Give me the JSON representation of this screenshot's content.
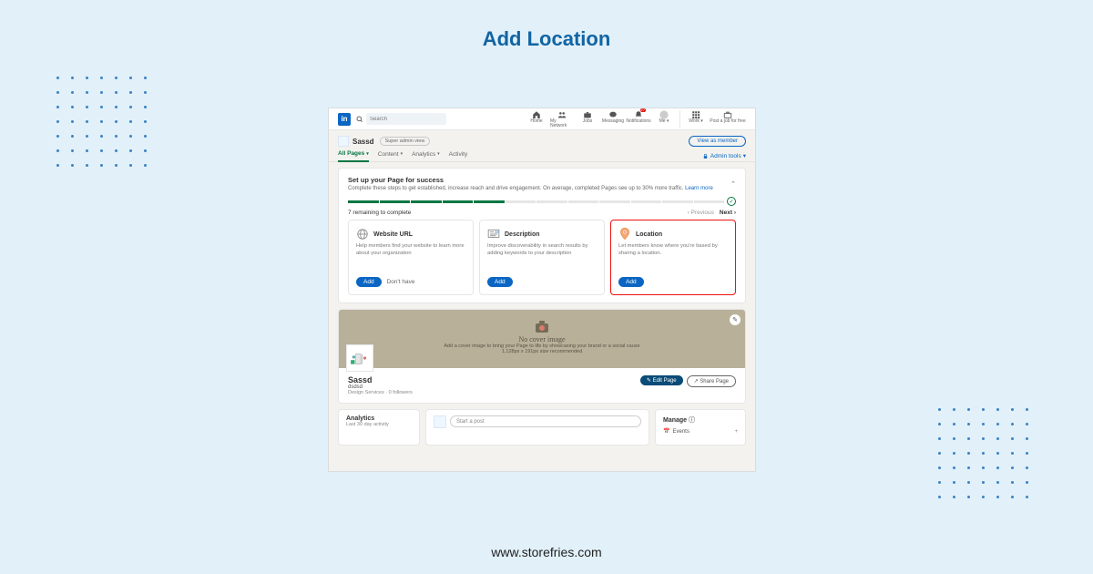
{
  "page_title": "Add Location",
  "footer_url": "www.storefries.com",
  "topbar": {
    "logo": "in",
    "search_placeholder": "Search",
    "nav": [
      {
        "label": "Home",
        "icon": "home"
      },
      {
        "label": "My Network",
        "icon": "people"
      },
      {
        "label": "Jobs",
        "icon": "briefcase"
      },
      {
        "label": "Messaging",
        "icon": "chat"
      },
      {
        "label": "Notifications",
        "icon": "bell",
        "badge": "27"
      },
      {
        "label": "Me",
        "icon": "avatar"
      },
      {
        "label": "Work",
        "icon": "grid"
      },
      {
        "label": "Post a job for free",
        "icon": "briefcase2"
      }
    ]
  },
  "page_header": {
    "name": "Sassd",
    "badge": "Super admin view",
    "view_btn": "View as member"
  },
  "tabs": {
    "items": [
      "All Pages",
      "Content",
      "Analytics",
      "Activity"
    ],
    "admin_tools": "Admin tools"
  },
  "setup": {
    "title": "Set up your Page for success",
    "subtitle": "Complete these steps to get established, increase reach and drive engagement. On average, completed Pages see up to 30% more traffic.",
    "learn_more": "Learn more",
    "done_segments": 5,
    "total_segments": 12,
    "remaining": "7 remaining to complete",
    "prev": "Previous",
    "next": "Next",
    "cards": [
      {
        "title": "Website URL",
        "desc": "Help members find your website to learn more about your organization",
        "add": "Add",
        "dont_have": "Don't have"
      },
      {
        "title": "Description",
        "desc": "Improve discoverability in search results by adding keywords to your description",
        "add": "Add"
      },
      {
        "title": "Location",
        "desc": "Let members know where you're based by sharing a location.",
        "add": "Add",
        "highlight": true
      }
    ]
  },
  "cover": {
    "title": "No cover image",
    "line1": "Add a cover image to bring your Page to life by showcasing your brand or a social cause",
    "line2": "1,128px x 191px size recommended"
  },
  "page_info": {
    "name": "Sassd",
    "slogan": "dsdsd",
    "meta": "Design Services · 0 followers",
    "edit": "Edit Page",
    "share": "Share Page"
  },
  "bottom": {
    "analytics": {
      "title": "Analytics",
      "sub": "Last 30 day activity"
    },
    "post_placeholder": "Start a post",
    "manage": {
      "title": "Manage",
      "row": "Events"
    }
  }
}
